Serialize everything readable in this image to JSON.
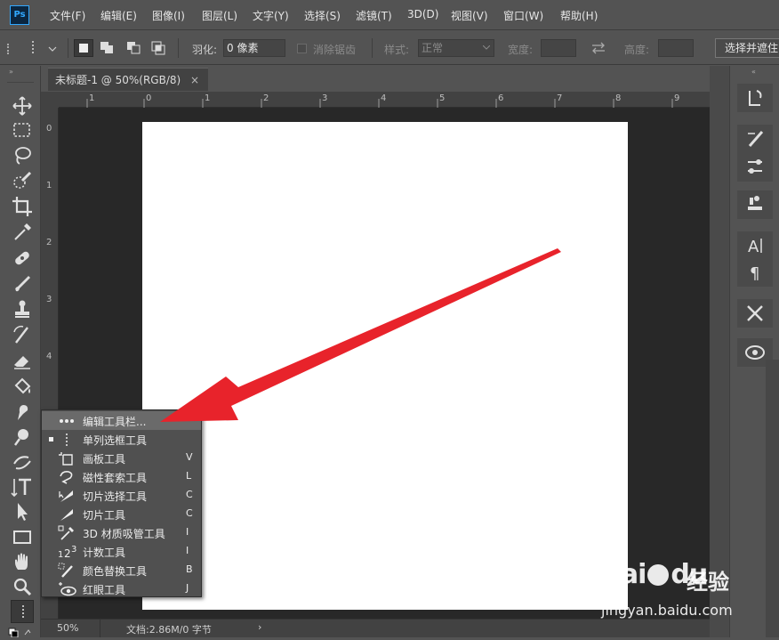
{
  "app": {
    "logo_text": "Ps"
  },
  "menu": [
    "文件(F)",
    "编辑(E)",
    "图像(I)",
    "图层(L)",
    "文字(Y)",
    "选择(S)",
    "滤镜(T)",
    "3D(D)",
    "视图(V)",
    "窗口(W)",
    "帮助(H)"
  ],
  "options": {
    "feather_label": "羽化:",
    "feather_value": "0 像素",
    "antialias_label": "消除锯齿",
    "style_label": "样式:",
    "style_value": "正常",
    "width_label": "宽度:",
    "height_label": "高度:",
    "select_mask_label": "选择并遮住"
  },
  "document": {
    "tab_title": "未标题-1 @ 50%(RGB/8)",
    "tab_close": "×",
    "zoom": "50%",
    "doc_info": "文档:2.86M/0 字节",
    "status_arrow": "›"
  },
  "ruler": {
    "top_ticks": [
      "1",
      "0",
      "1",
      "2",
      "3",
      "4",
      "5",
      "6",
      "7",
      "8",
      "9",
      "1"
    ],
    "left_ticks": [
      "0",
      "1",
      "2",
      "3",
      "4"
    ]
  },
  "flyout": {
    "items": [
      {
        "label": "编辑工具栏...",
        "key": "",
        "icon": "more-dots-icon",
        "highlighted": true
      },
      {
        "label": "单列选框工具",
        "key": "",
        "icon": "single-column-marquee-icon",
        "selected": true
      },
      {
        "label": "画板工具",
        "key": "V",
        "icon": "artboard-icon"
      },
      {
        "label": "磁性套索工具",
        "key": "L",
        "icon": "magnetic-lasso-icon"
      },
      {
        "label": "切片选择工具",
        "key": "C",
        "icon": "slice-select-icon"
      },
      {
        "label": "切片工具",
        "key": "C",
        "icon": "slice-icon"
      },
      {
        "label": "3D 材质吸管工具",
        "key": "I",
        "icon": "3d-material-eyedropper-icon"
      },
      {
        "label": "计数工具",
        "key": "I",
        "icon": "count-icon"
      },
      {
        "label": "颜色替换工具",
        "key": "B",
        "icon": "color-replacement-icon"
      },
      {
        "label": "红眼工具",
        "key": "J",
        "icon": "red-eye-icon"
      }
    ]
  },
  "watermark": {
    "logo": "Bai",
    "logo_tail": "du",
    "cn_text": "经验",
    "url": "jingyan.baidu.com"
  },
  "colors": {
    "arrow": "#e8232b",
    "ui_bg": "#535353",
    "canvas_bg": "#282828"
  }
}
